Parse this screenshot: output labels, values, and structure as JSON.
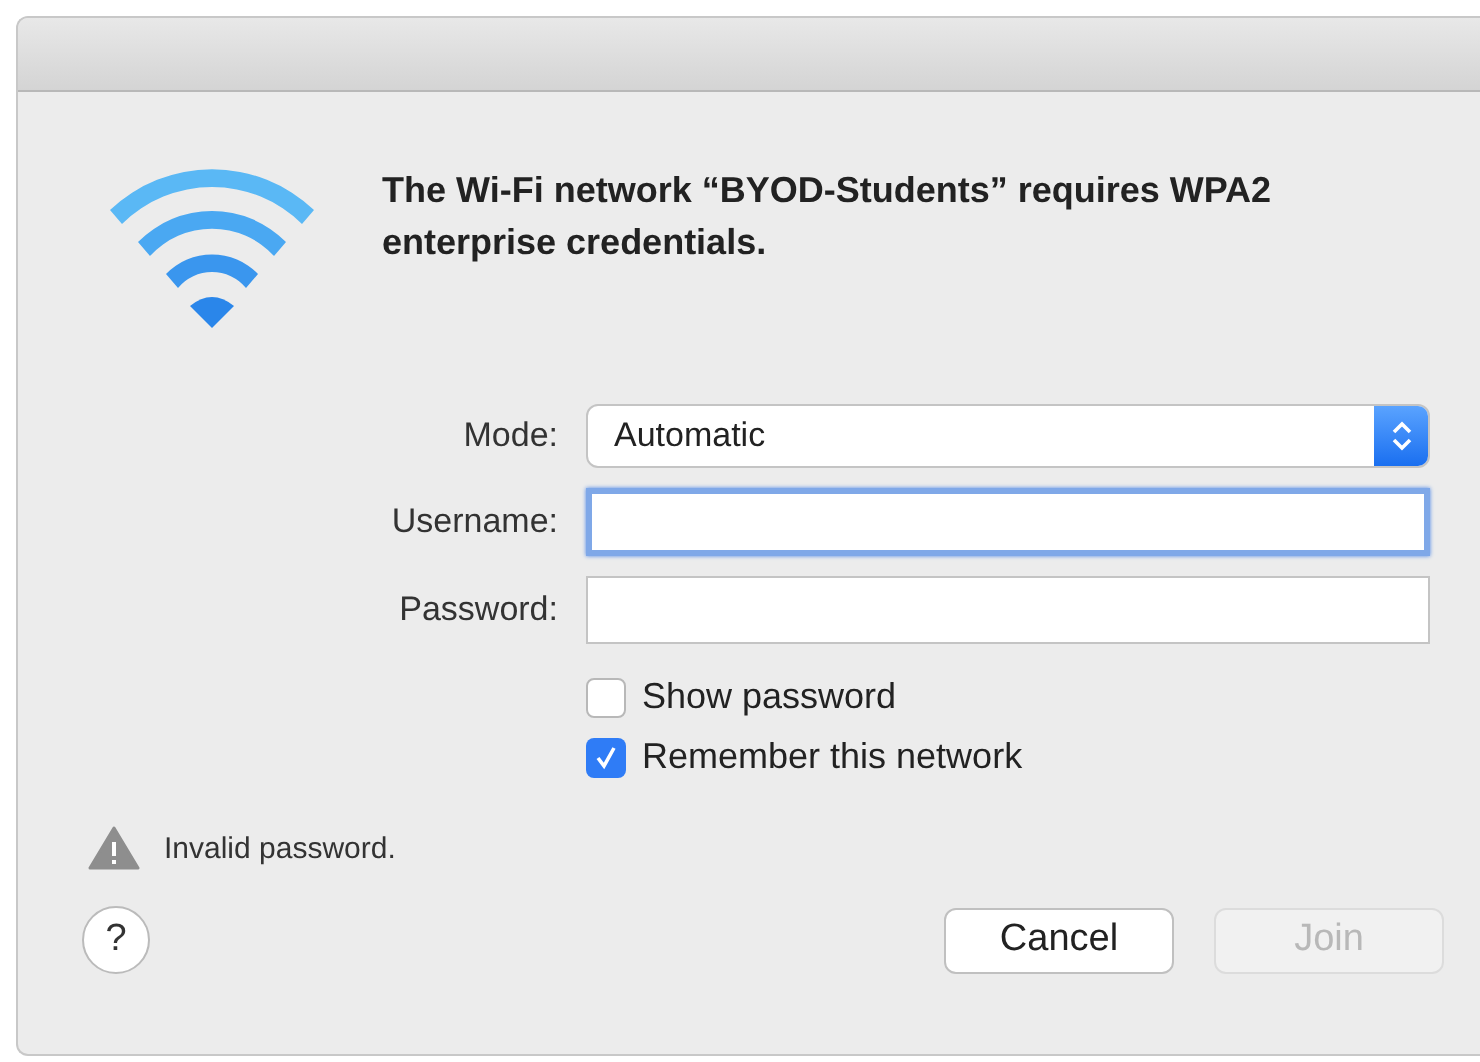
{
  "dialog": {
    "message": "The Wi-Fi network “BYOD-Students” requires WPA2 enterprise credentials.",
    "fields": [
      {
        "kind": "select",
        "label": "Mode:",
        "value": "Automatic"
      },
      {
        "kind": "text",
        "label": "Username:",
        "focused": true
      },
      {
        "kind": "password",
        "label": "Password:"
      }
    ],
    "checkboxes": [
      {
        "label": "Show password",
        "checked": false
      },
      {
        "label": "Remember this network",
        "checked": true
      }
    ],
    "error": "Invalid password.",
    "help": "?",
    "buttons": [
      {
        "label": "Cancel",
        "disabled": false
      },
      {
        "label": "Join",
        "disabled": true
      }
    ]
  }
}
